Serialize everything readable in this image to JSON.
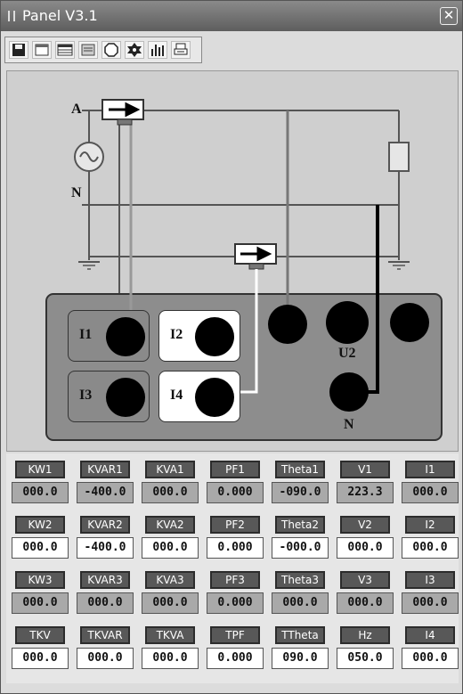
{
  "window": {
    "title": "Panel  V3.1",
    "close_label": "✕"
  },
  "toolbar": {
    "icons": [
      "save-icon",
      "window-icon",
      "table-icon",
      "list-icon",
      "octagon-icon",
      "gear-icon",
      "bar-chart-icon",
      "printer-icon"
    ]
  },
  "diagram": {
    "labels": {
      "phase_a": "A",
      "neutral_top": "N",
      "i1": "I1",
      "i2": "I2",
      "i3": "I3",
      "i4": "I4",
      "u2": "U2",
      "n_bottom": "N"
    }
  },
  "meters": {
    "rows": [
      [
        {
          "label": "KW1",
          "value": "000.0",
          "shaded": true
        },
        {
          "label": "KVAR1",
          "value": "-400.0",
          "shaded": true
        },
        {
          "label": "KVA1",
          "value": "000.0",
          "shaded": true
        },
        {
          "label": "PF1",
          "value": "0.000",
          "shaded": true
        },
        {
          "label": "Theta1",
          "value": "-090.0",
          "shaded": true
        },
        {
          "label": "V1",
          "value": "223.3",
          "shaded": true
        },
        {
          "label": "I1",
          "value": "000.0",
          "shaded": true
        }
      ],
      [
        {
          "label": "KW2",
          "value": "000.0",
          "shaded": false
        },
        {
          "label": "KVAR2",
          "value": "-400.0",
          "shaded": false
        },
        {
          "label": "KVA2",
          "value": "000.0",
          "shaded": false
        },
        {
          "label": "PF2",
          "value": "0.000",
          "shaded": false
        },
        {
          "label": "Theta2",
          "value": "-000.0",
          "shaded": false
        },
        {
          "label": "V2",
          "value": "000.0",
          "shaded": false
        },
        {
          "label": "I2",
          "value": "000.0",
          "shaded": false
        }
      ],
      [
        {
          "label": "KW3",
          "value": "000.0",
          "shaded": true
        },
        {
          "label": "KVAR3",
          "value": "000.0",
          "shaded": true
        },
        {
          "label": "KVA3",
          "value": "000.0",
          "shaded": true
        },
        {
          "label": "PF3",
          "value": "0.000",
          "shaded": true
        },
        {
          "label": "Theta3",
          "value": "000.0",
          "shaded": true
        },
        {
          "label": "V3",
          "value": "000.0",
          "shaded": true
        },
        {
          "label": "I3",
          "value": "000.0",
          "shaded": true
        }
      ],
      [
        {
          "label": "TKV",
          "value": "000.0",
          "shaded": false
        },
        {
          "label": "TKVAR",
          "value": "000.0",
          "shaded": false
        },
        {
          "label": "TKVA",
          "value": "000.0",
          "shaded": false
        },
        {
          "label": "TPF",
          "value": "0.000",
          "shaded": false
        },
        {
          "label": "TTheta",
          "value": "090.0",
          "shaded": false
        },
        {
          "label": "Hz",
          "value": "050.0",
          "shaded": false
        },
        {
          "label": "I4",
          "value": "000.0",
          "shaded": false
        }
      ]
    ]
  }
}
